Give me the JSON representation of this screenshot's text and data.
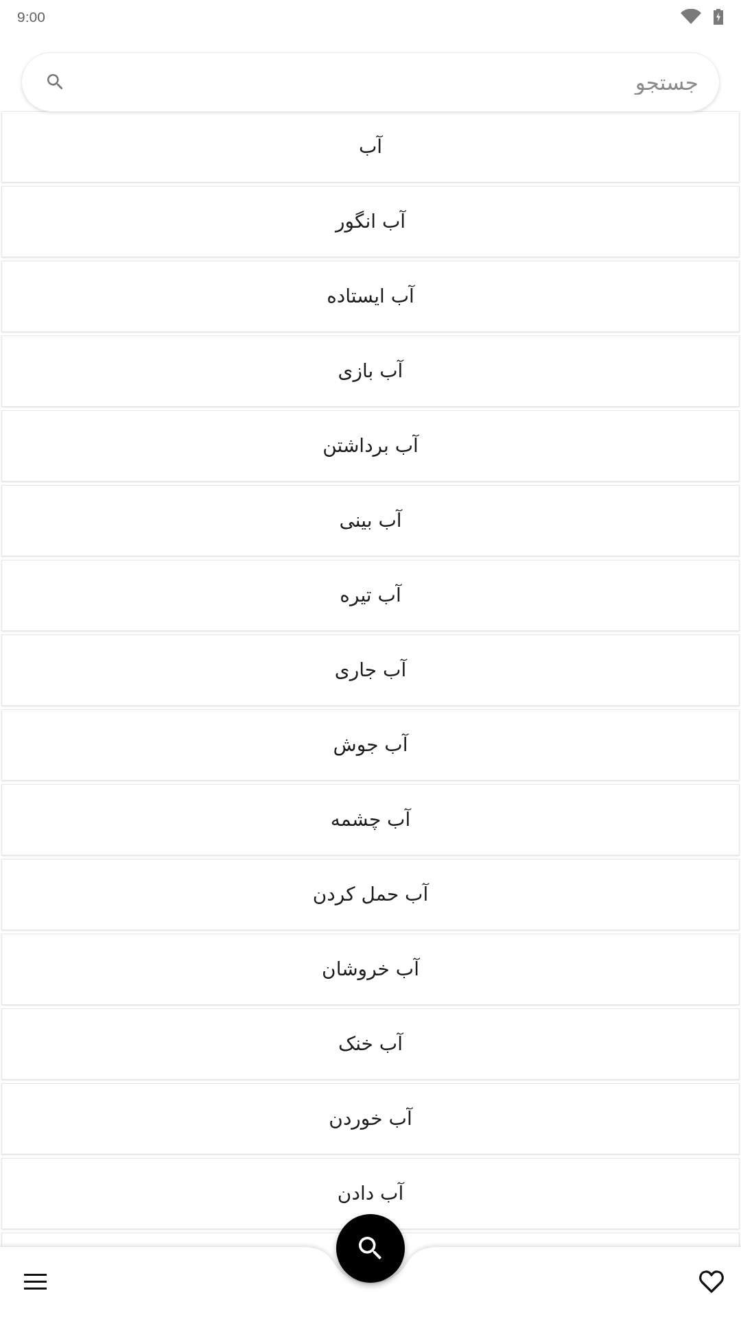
{
  "status_bar": {
    "time": "9:00"
  },
  "search": {
    "placeholder": "جستجو"
  },
  "list": {
    "items": [
      {
        "label": "آب"
      },
      {
        "label": "آب انگور"
      },
      {
        "label": "آب ایستاده"
      },
      {
        "label": "آب بازی"
      },
      {
        "label": "آب برداشتن"
      },
      {
        "label": "آب بینی"
      },
      {
        "label": "آب تیره"
      },
      {
        "label": "آب جاری"
      },
      {
        "label": "آب جوش"
      },
      {
        "label": "آب چشمه"
      },
      {
        "label": "آب حمل کردن"
      },
      {
        "label": "آب خروشان"
      },
      {
        "label": "آب خنک"
      },
      {
        "label": "آب خوردن"
      },
      {
        "label": "آب دادن"
      }
    ],
    "more_below": true
  }
}
